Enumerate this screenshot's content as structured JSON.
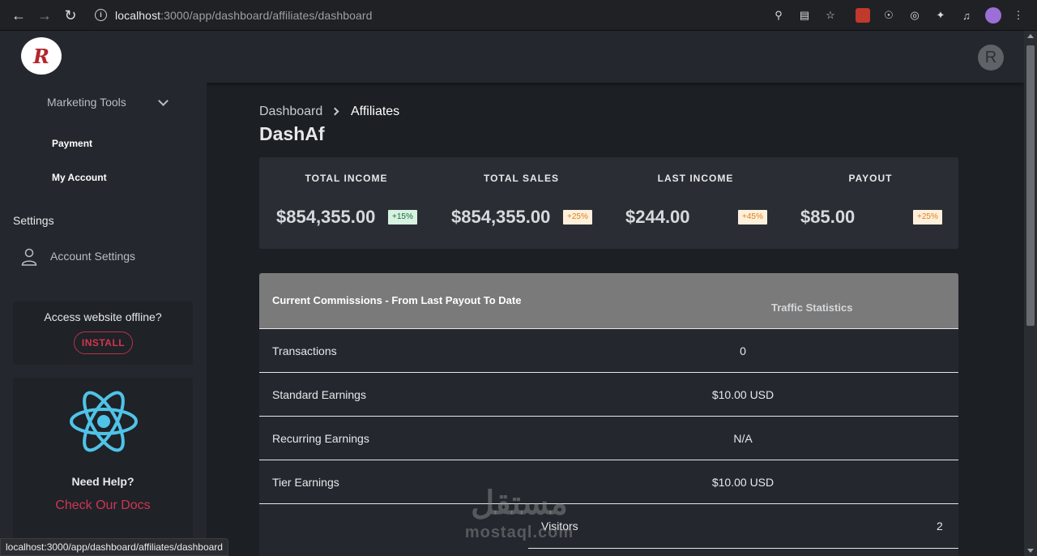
{
  "browser": {
    "url_host": "localhost",
    "url_path": ":3000/app/dashboard/affiliates/dashboard",
    "status_url": "localhost:3000/app/dashboard/affiliates/dashboard"
  },
  "header": {
    "logo_letter": "R",
    "avatar_letter": "R"
  },
  "sidebar": {
    "marketing_tools": "Marketing Tools",
    "payment": "Payment",
    "my_account": "My Account",
    "settings_heading": "Settings",
    "account_settings": "Account Settings",
    "offline_question": "Access website offline?",
    "install_label": "INSTALL",
    "need_help": "Need Help?",
    "check_docs": "Check Our Docs"
  },
  "breadcrumb": {
    "first": "Dashboard",
    "second": "Affiliates"
  },
  "page_title": "DashAf",
  "stats": [
    {
      "label": "TOTAL INCOME",
      "value": "$854,355.00",
      "badge": "+15%",
      "badge_color": "#d6f2e1"
    },
    {
      "label": "TOTAL SALES",
      "value": "$854,355.00",
      "badge": "+25%",
      "badge_color": "#fff0dc"
    },
    {
      "label": "LAST INCOME",
      "value": "$244.00",
      "badge": "+45%",
      "badge_color": "#fff0dc"
    },
    {
      "label": "PAYOUT",
      "value": "$85.00",
      "badge": "+25%",
      "badge_color": "#fff0dc"
    }
  ],
  "commissions_table": {
    "header_left": "Current Commissions - From Last Payout To Date",
    "header_right": "Traffic Statistics",
    "rows": [
      {
        "label": "Transactions",
        "value": "0"
      },
      {
        "label": "Standard Earnings",
        "value": "$10.00 USD"
      },
      {
        "label": "Recurring Earnings",
        "value": "N/A"
      },
      {
        "label": "Tier Earnings",
        "value": "$10.00 USD"
      }
    ],
    "traffic_rows": [
      {
        "label": "Visitors",
        "value": "2"
      }
    ]
  },
  "watermark": {
    "arabic": "مستقل",
    "latin": "mostaql.com"
  },
  "colors": {
    "accent_red": "#cf3654",
    "background": "#1c1f24",
    "panel": "#24282e"
  }
}
